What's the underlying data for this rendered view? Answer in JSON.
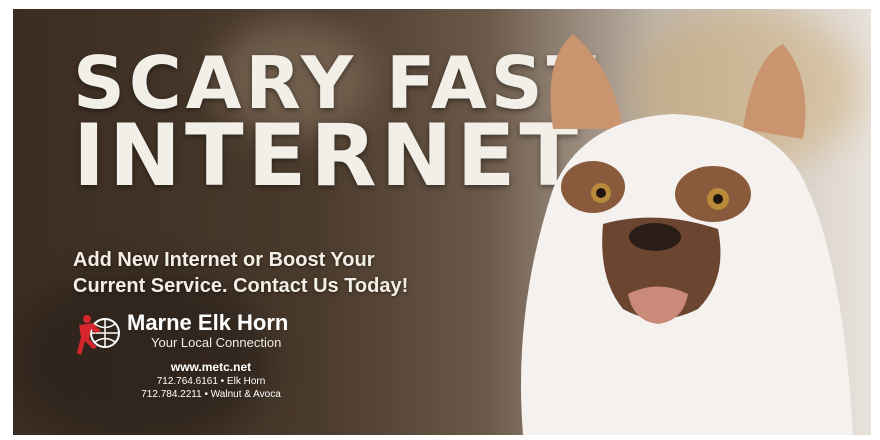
{
  "headline": {
    "line1": "SCARY FAST",
    "line2": "INTERNET"
  },
  "subhead": {
    "line1": "Add New Internet or Boost Your",
    "line2": "Current Service. Contact Us Today!"
  },
  "brand": {
    "name": "Marne Elk Horn",
    "tagline": "Your Local Connection",
    "icon": "globe-runner-logo",
    "color": "#d7262b"
  },
  "contact": {
    "url": "www.metc.net",
    "phone1": "712.764.6161 • Elk Horn",
    "phone2": "712.784.2211 • Walnut & Avoca"
  }
}
